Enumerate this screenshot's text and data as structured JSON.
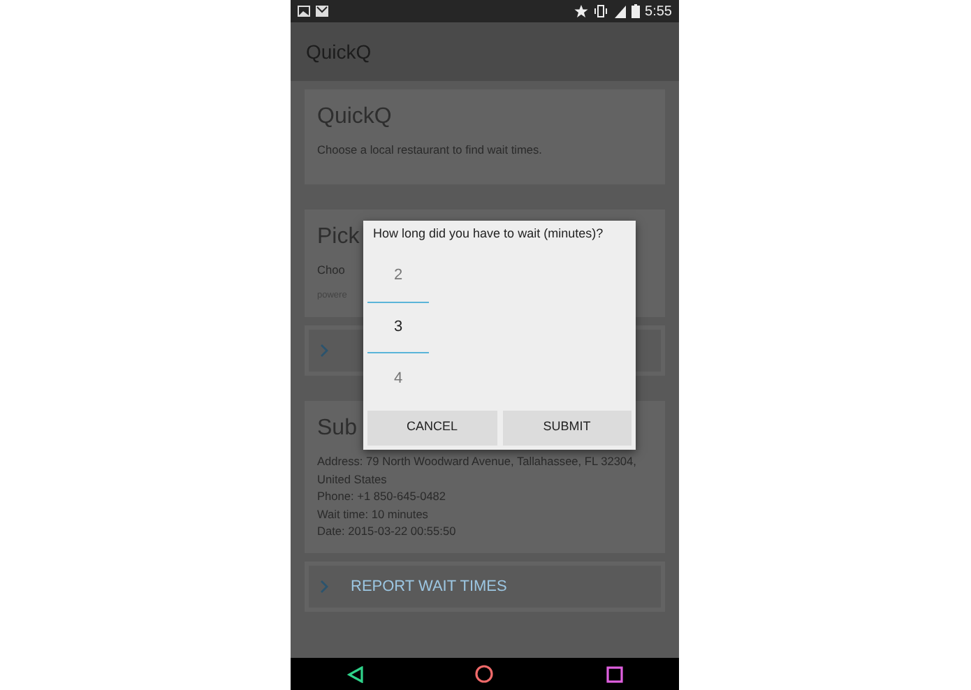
{
  "status_bar": {
    "time": "5:55"
  },
  "app_bar": {
    "title": "QuickQ"
  },
  "cards": [
    {
      "kind": "intro",
      "title": "QuickQ",
      "text": "Choose a local restaurant to find wait times."
    },
    {
      "kind": "pick",
      "title": "Pick",
      "text": "Choo",
      "note": "powere"
    },
    {
      "kind": "link"
    },
    {
      "kind": "details",
      "title": "Sub",
      "lines": [
        "Address: 79 North Woodward Avenue, Tallahassee, FL 32304, United States",
        "Phone: +1 850-645-0482",
        "Wait time: 10 minutes",
        "Date: 2015-03-22 00:55:50"
      ]
    },
    {
      "kind": "link",
      "label": "REPORT WAIT TIMES"
    }
  ],
  "dialog": {
    "title": "How long did you have to wait (minutes)?",
    "picker": [
      {
        "value": "2",
        "selected": false
      },
      {
        "value": "3",
        "selected": true
      },
      {
        "value": "4",
        "selected": false
      }
    ],
    "buttons": [
      "CANCEL",
      "SUBMIT"
    ]
  }
}
